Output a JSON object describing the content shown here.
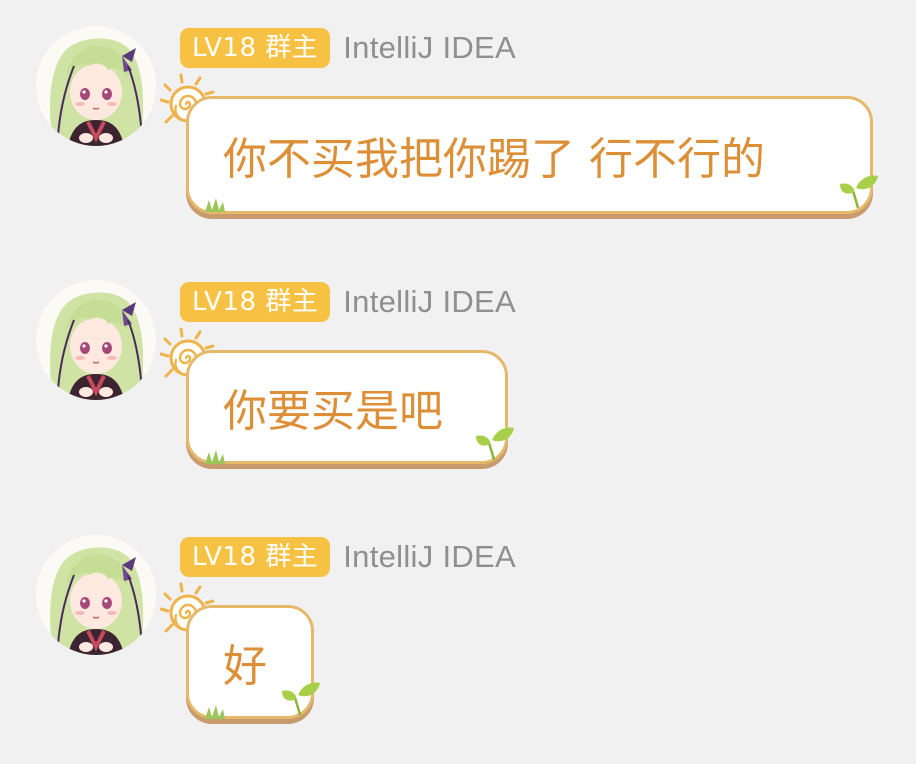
{
  "colors": {
    "background": "#f1f1f1",
    "badge_bg": "#f7c244",
    "badge_text": "#ffffff",
    "sender_text": "#8f8f8f",
    "bubble_text": "#dd8f38",
    "bubble_border": "#e6b86a"
  },
  "messages": [
    {
      "badge": "LV18 群主",
      "sender": "IntelliJ IDEA",
      "text": "你不买我把你踢了 行不行的",
      "avatar_icon": "anime-girl-avatar-icon"
    },
    {
      "badge": "LV18 群主",
      "sender": "IntelliJ IDEA",
      "text": "你要买是吧",
      "avatar_icon": "anime-girl-avatar-icon"
    },
    {
      "badge": "LV18 群主",
      "sender": "IntelliJ IDEA",
      "text": "好",
      "avatar_icon": "anime-girl-avatar-icon"
    }
  ]
}
